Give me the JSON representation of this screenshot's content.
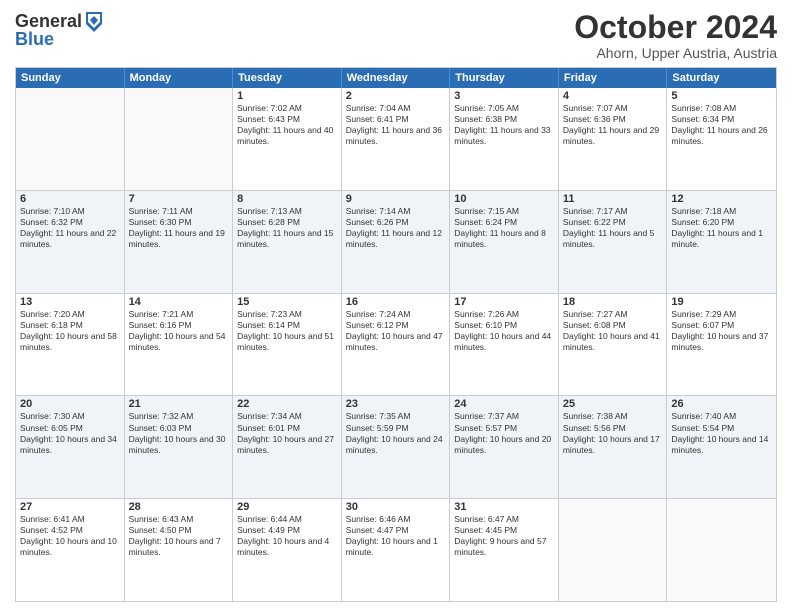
{
  "logo": {
    "general": "General",
    "blue": "Blue"
  },
  "header": {
    "month": "October 2024",
    "location": "Ahorn, Upper Austria, Austria"
  },
  "days": [
    "Sunday",
    "Monday",
    "Tuesday",
    "Wednesday",
    "Thursday",
    "Friday",
    "Saturday"
  ],
  "weeks": [
    [
      {
        "day": "",
        "info": ""
      },
      {
        "day": "",
        "info": ""
      },
      {
        "day": "1",
        "info": "Sunrise: 7:02 AM\nSunset: 6:43 PM\nDaylight: 11 hours and 40 minutes."
      },
      {
        "day": "2",
        "info": "Sunrise: 7:04 AM\nSunset: 6:41 PM\nDaylight: 11 hours and 36 minutes."
      },
      {
        "day": "3",
        "info": "Sunrise: 7:05 AM\nSunset: 6:38 PM\nDaylight: 11 hours and 33 minutes."
      },
      {
        "day": "4",
        "info": "Sunrise: 7:07 AM\nSunset: 6:36 PM\nDaylight: 11 hours and 29 minutes."
      },
      {
        "day": "5",
        "info": "Sunrise: 7:08 AM\nSunset: 6:34 PM\nDaylight: 11 hours and 26 minutes."
      }
    ],
    [
      {
        "day": "6",
        "info": "Sunrise: 7:10 AM\nSunset: 6:32 PM\nDaylight: 11 hours and 22 minutes."
      },
      {
        "day": "7",
        "info": "Sunrise: 7:11 AM\nSunset: 6:30 PM\nDaylight: 11 hours and 19 minutes."
      },
      {
        "day": "8",
        "info": "Sunrise: 7:13 AM\nSunset: 6:28 PM\nDaylight: 11 hours and 15 minutes."
      },
      {
        "day": "9",
        "info": "Sunrise: 7:14 AM\nSunset: 6:26 PM\nDaylight: 11 hours and 12 minutes."
      },
      {
        "day": "10",
        "info": "Sunrise: 7:15 AM\nSunset: 6:24 PM\nDaylight: 11 hours and 8 minutes."
      },
      {
        "day": "11",
        "info": "Sunrise: 7:17 AM\nSunset: 6:22 PM\nDaylight: 11 hours and 5 minutes."
      },
      {
        "day": "12",
        "info": "Sunrise: 7:18 AM\nSunset: 6:20 PM\nDaylight: 11 hours and 1 minute."
      }
    ],
    [
      {
        "day": "13",
        "info": "Sunrise: 7:20 AM\nSunset: 6:18 PM\nDaylight: 10 hours and 58 minutes."
      },
      {
        "day": "14",
        "info": "Sunrise: 7:21 AM\nSunset: 6:16 PM\nDaylight: 10 hours and 54 minutes."
      },
      {
        "day": "15",
        "info": "Sunrise: 7:23 AM\nSunset: 6:14 PM\nDaylight: 10 hours and 51 minutes."
      },
      {
        "day": "16",
        "info": "Sunrise: 7:24 AM\nSunset: 6:12 PM\nDaylight: 10 hours and 47 minutes."
      },
      {
        "day": "17",
        "info": "Sunrise: 7:26 AM\nSunset: 6:10 PM\nDaylight: 10 hours and 44 minutes."
      },
      {
        "day": "18",
        "info": "Sunrise: 7:27 AM\nSunset: 6:08 PM\nDaylight: 10 hours and 41 minutes."
      },
      {
        "day": "19",
        "info": "Sunrise: 7:29 AM\nSunset: 6:07 PM\nDaylight: 10 hours and 37 minutes."
      }
    ],
    [
      {
        "day": "20",
        "info": "Sunrise: 7:30 AM\nSunset: 6:05 PM\nDaylight: 10 hours and 34 minutes."
      },
      {
        "day": "21",
        "info": "Sunrise: 7:32 AM\nSunset: 6:03 PM\nDaylight: 10 hours and 30 minutes."
      },
      {
        "day": "22",
        "info": "Sunrise: 7:34 AM\nSunset: 6:01 PM\nDaylight: 10 hours and 27 minutes."
      },
      {
        "day": "23",
        "info": "Sunrise: 7:35 AM\nSunset: 5:59 PM\nDaylight: 10 hours and 24 minutes."
      },
      {
        "day": "24",
        "info": "Sunrise: 7:37 AM\nSunset: 5:57 PM\nDaylight: 10 hours and 20 minutes."
      },
      {
        "day": "25",
        "info": "Sunrise: 7:38 AM\nSunset: 5:56 PM\nDaylight: 10 hours and 17 minutes."
      },
      {
        "day": "26",
        "info": "Sunrise: 7:40 AM\nSunset: 5:54 PM\nDaylight: 10 hours and 14 minutes."
      }
    ],
    [
      {
        "day": "27",
        "info": "Sunrise: 6:41 AM\nSunset: 4:52 PM\nDaylight: 10 hours and 10 minutes."
      },
      {
        "day": "28",
        "info": "Sunrise: 6:43 AM\nSunset: 4:50 PM\nDaylight: 10 hours and 7 minutes."
      },
      {
        "day": "29",
        "info": "Sunrise: 6:44 AM\nSunset: 4:49 PM\nDaylight: 10 hours and 4 minutes."
      },
      {
        "day": "30",
        "info": "Sunrise: 6:46 AM\nSunset: 4:47 PM\nDaylight: 10 hours and 1 minute."
      },
      {
        "day": "31",
        "info": "Sunrise: 6:47 AM\nSunset: 4:45 PM\nDaylight: 9 hours and 57 minutes."
      },
      {
        "day": "",
        "info": ""
      },
      {
        "day": "",
        "info": ""
      }
    ]
  ]
}
